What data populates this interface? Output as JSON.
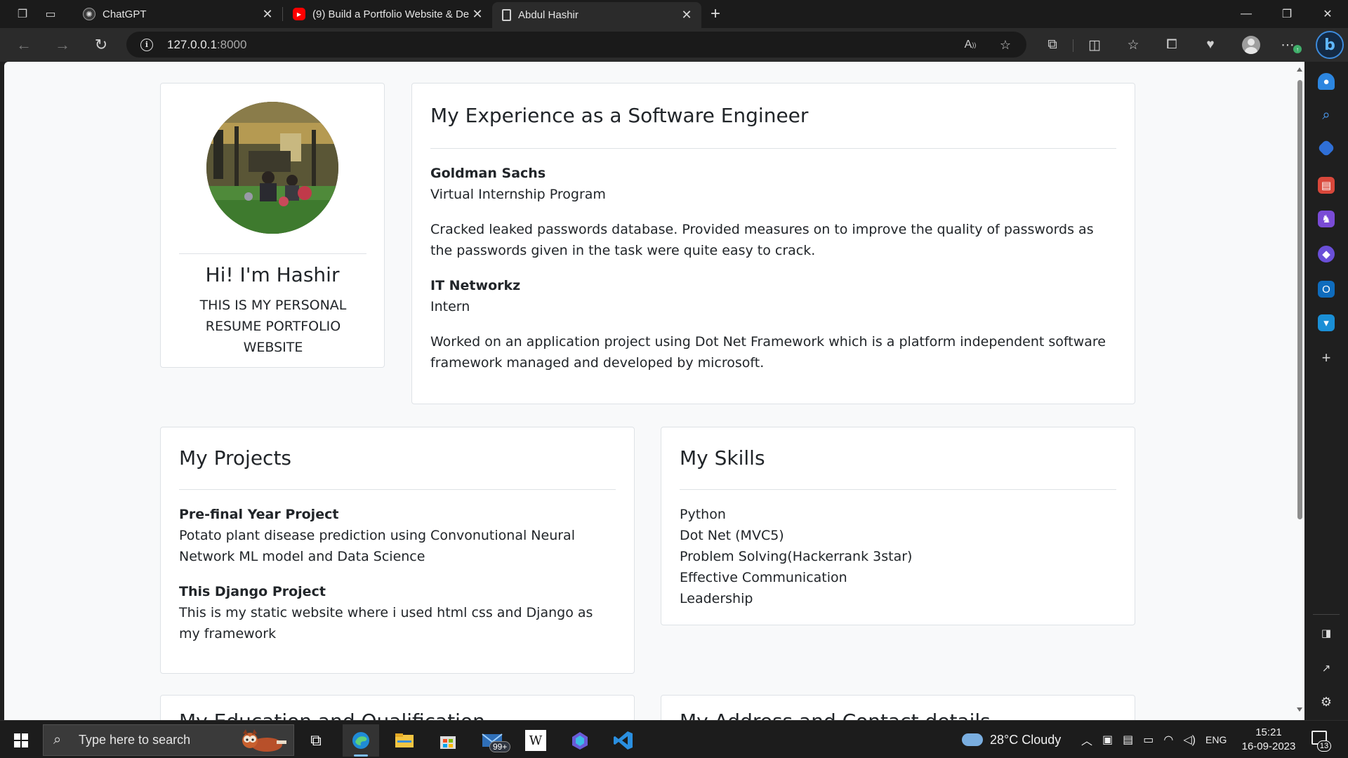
{
  "browser": {
    "tabs": [
      {
        "title": "ChatGPT",
        "icon": "chatgpt-icon"
      },
      {
        "title": "(9) Build a Portfolio Website & De",
        "icon": "youtube-icon"
      },
      {
        "title": "Abdul Hashir",
        "icon": "document-icon"
      }
    ],
    "address": {
      "host": "127.0.0.1",
      "port": ":8000"
    }
  },
  "profile": {
    "name": "Hi! I'm Hashir",
    "tagline": "THIS IS MY PERSONAL RESUME PORTFOLIO WEBSITE"
  },
  "experience": {
    "heading": "My Experience as a Software Engineer",
    "items": [
      {
        "company": "Goldman Sachs",
        "role": "Virtual Internship Program",
        "description": "Cracked leaked passwords database. Provided measures on to improve the quality of passwords as the passwords given in the task were quite easy to crack."
      },
      {
        "company": "IT Networkz",
        "role": "Intern",
        "description": "Worked on an application project using Dot Net Framework which is a platform independent software framework managed and developed by microsoft."
      }
    ]
  },
  "projects": {
    "heading": "My Projects",
    "items": [
      {
        "title": "Pre-final Year Project",
        "description": "Potato plant disease prediction using Convonutional Neural Network ML model and Data Science"
      },
      {
        "title": "This Django Project",
        "description": "This is my static website where i used html css and Django as my framework"
      }
    ]
  },
  "skills": {
    "heading": "My Skills",
    "items": [
      "Python",
      "Dot Net (MVC5)",
      "Problem Solving(Hackerrank 3star)",
      "Effective Communication",
      "Leadership"
    ]
  },
  "partial_cards": {
    "left_heading": "My Education and Qualification",
    "right_heading": "My Address and Contact details"
  },
  "taskbar": {
    "search_placeholder": "Type here to search",
    "mail_badge": "99+",
    "weather": "28°C  Cloudy",
    "language": "ENG",
    "time": "15:21",
    "date": "16-09-2023",
    "notification_count": "13"
  },
  "colors": {
    "page_bg": "#f8f9fa",
    "card_border": "#dee2e6",
    "text": "#212529",
    "browser_dark": "#1b1b1b",
    "accent": "#3d8bdc"
  }
}
